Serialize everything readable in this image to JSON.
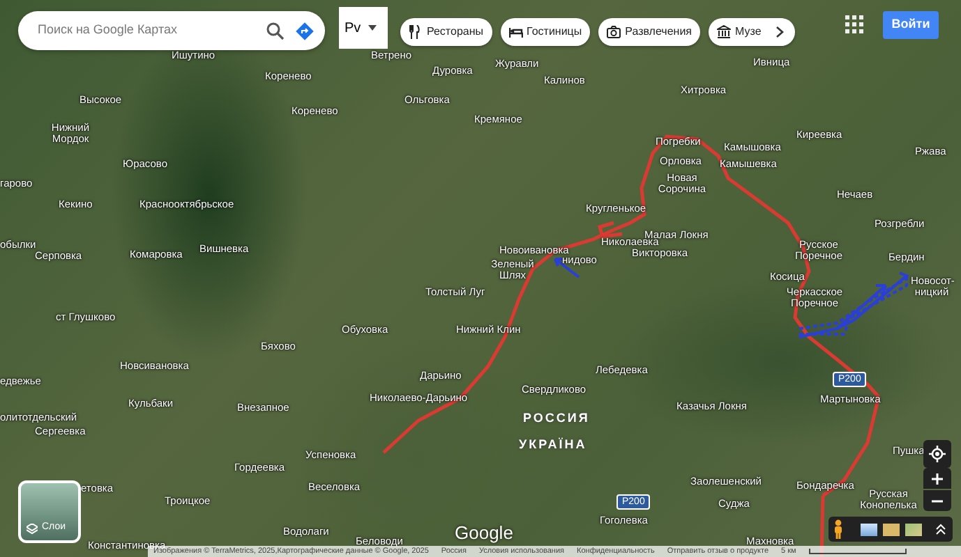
{
  "search": {
    "placeholder": "Поиск на Google Картах"
  },
  "language": {
    "label": "Pv"
  },
  "categories": [
    {
      "label": "Рестораны",
      "kind": "restaurant"
    },
    {
      "label": "Гостиницы",
      "kind": "hotel"
    },
    {
      "label": "Развлечения",
      "kind": "camera"
    },
    {
      "label": "Музе",
      "kind": "museum"
    }
  ],
  "account": {
    "sign_in": "Войти"
  },
  "map_labels": [
    {
      "text": "Ишутино",
      "kind": "place"
    },
    {
      "text": "Ветрено",
      "kind": "place"
    },
    {
      "text": "Коренево",
      "kind": "place"
    },
    {
      "text": "Дуровка",
      "kind": "place"
    },
    {
      "text": "Журавли",
      "kind": "place"
    },
    {
      "text": "Калинов",
      "kind": "place"
    },
    {
      "text": "Ивница",
      "kind": "place"
    },
    {
      "text": "Высокое",
      "kind": "place"
    },
    {
      "text": "Ольговка",
      "kind": "place"
    },
    {
      "text": "Коренево",
      "kind": "place"
    },
    {
      "text": "Хитровка",
      "kind": "place"
    },
    {
      "text": "Кремяное",
      "kind": "place"
    },
    {
      "text": "Нижний Мордок",
      "kind": "place"
    },
    {
      "text": "Киреевка",
      "kind": "place"
    },
    {
      "text": "Погребки",
      "kind": "place"
    },
    {
      "text": "Камышовка",
      "kind": "place"
    },
    {
      "text": "Ржава",
      "kind": "place"
    },
    {
      "text": "Юрасово",
      "kind": "place"
    },
    {
      "text": "Орловка",
      "kind": "place"
    },
    {
      "text": "Камышевка",
      "kind": "place"
    },
    {
      "text": "гарово",
      "kind": "place"
    },
    {
      "text": "Новая Сорочина",
      "kind": "place"
    },
    {
      "text": "Нечаев",
      "kind": "place"
    },
    {
      "text": "Кекино",
      "kind": "place"
    },
    {
      "text": "Краснооктябрьское",
      "kind": "place"
    },
    {
      "text": "Кругленькое",
      "kind": "place"
    },
    {
      "text": "Розгребли",
      "kind": "place"
    },
    {
      "text": "Малая Локня",
      "kind": "place"
    },
    {
      "text": "Николаевка",
      "kind": "place"
    },
    {
      "text": "Новоивановка",
      "kind": "place"
    },
    {
      "text": "Викторовка",
      "kind": "place"
    },
    {
      "text": "обылки",
      "kind": "place"
    },
    {
      "text": "Серповка",
      "kind": "place"
    },
    {
      "text": "Комаровка",
      "kind": "place"
    },
    {
      "text": "Вишневка",
      "kind": "place"
    },
    {
      "text": "Русское Поречное",
      "kind": "place"
    },
    {
      "text": "Бердин",
      "kind": "place"
    },
    {
      "text": "Зеленый Шлях",
      "kind": "place"
    },
    {
      "text": "нидово",
      "kind": "place"
    },
    {
      "text": "Косица",
      "kind": "place"
    },
    {
      "text": "Толстый Луг",
      "kind": "place"
    },
    {
      "text": "Новосот- ницкий",
      "kind": "place"
    },
    {
      "text": "Черкасское Поречное",
      "kind": "place"
    },
    {
      "text": "ст Глушково",
      "kind": "place"
    },
    {
      "text": "Обуховка",
      "kind": "place"
    },
    {
      "text": "Нижний Клин",
      "kind": "place"
    },
    {
      "text": "Бяхово",
      "kind": "place"
    },
    {
      "text": "Новсивановка",
      "kind": "place"
    },
    {
      "text": "Лебедевка",
      "kind": "place"
    },
    {
      "text": "Дарьино",
      "kind": "place"
    },
    {
      "text": "едвежье",
      "kind": "place"
    },
    {
      "text": "Свердликово",
      "kind": "place"
    },
    {
      "text": "Р200",
      "kind": "road"
    },
    {
      "text": "Николаево-Дарьино",
      "kind": "place"
    },
    {
      "text": "Мартыновка",
      "kind": "place"
    },
    {
      "text": "Кульбаки",
      "kind": "place"
    },
    {
      "text": "Внезапное",
      "kind": "place"
    },
    {
      "text": "Казачья Локня",
      "kind": "place"
    },
    {
      "text": "олитотдельский",
      "kind": "place"
    },
    {
      "text": "РОССИЯ",
      "kind": "border"
    },
    {
      "text": "Сергеевка",
      "kind": "place"
    },
    {
      "text": "УКРАЇНА",
      "kind": "border"
    },
    {
      "text": "Успеновка",
      "kind": "place"
    },
    {
      "text": "Пушка",
      "kind": "place"
    },
    {
      "text": "Гордеевка",
      "kind": "place"
    },
    {
      "text": "етовка",
      "kind": "place"
    },
    {
      "text": "Веселовка",
      "kind": "place"
    },
    {
      "text": "Заолешенский",
      "kind": "place"
    },
    {
      "text": "Бондаречка",
      "kind": "place"
    },
    {
      "text": "Троицкое",
      "kind": "place"
    },
    {
      "text": "Р200",
      "kind": "road"
    },
    {
      "text": "Суджа",
      "kind": "place"
    },
    {
      "text": "Русская Конопелька",
      "kind": "place"
    },
    {
      "text": "Гоголевка",
      "kind": "place"
    },
    {
      "text": "Водолаги",
      "kind": "place"
    },
    {
      "text": "Константиновка",
      "kind": "place"
    },
    {
      "text": "Беловоди",
      "kind": "place"
    },
    {
      "text": "Махновка",
      "kind": "place"
    }
  ],
  "layers": {
    "label": "Слои"
  },
  "logo": "Google",
  "footer": {
    "attribution": "Изображения © TerraMetrics, 2025,Картографические данные © Google, 2025",
    "country": "Россия",
    "links": [
      "Условия использования",
      "Конфиденциальность",
      "Отправить отзыв о продукте"
    ],
    "scale": "5 км"
  }
}
